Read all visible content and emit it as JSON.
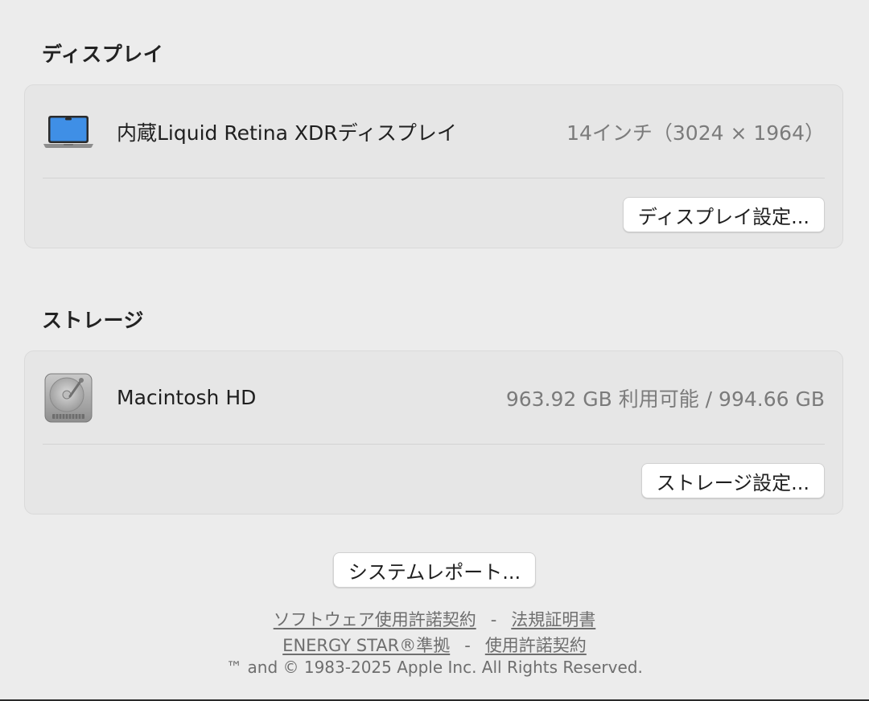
{
  "display_section": {
    "title": "ディスプレイ",
    "item_name": "内蔵Liquid Retina XDRディスプレイ",
    "item_value": "14インチ（3024 × 1964）",
    "settings_button": "ディスプレイ設定...",
    "icon": "laptop-icon"
  },
  "storage_section": {
    "title": "ストレージ",
    "item_name": "Macintosh HD",
    "item_value": "963.92 GB 利用可能 / 994.66 GB",
    "settings_button": "ストレージ設定...",
    "icon": "hard-drive-icon"
  },
  "system_report_button": "システムレポート...",
  "footer": {
    "links_row1": [
      {
        "label": "ソフトウェア使用許諾契約"
      },
      {
        "label": "法規証明書"
      }
    ],
    "links_row2": [
      {
        "label": "ENERGY STAR®準拠"
      },
      {
        "label": "使用許諾契約"
      }
    ],
    "separator": "-",
    "copyright": "™ and © 1983-2025 Apple Inc. All Rights Reserved."
  },
  "colors": {
    "background": "#ececec",
    "card": "#e6e6e6",
    "secondary_text": "#7b7b7b",
    "screen_blue": "#3f8fe6"
  }
}
